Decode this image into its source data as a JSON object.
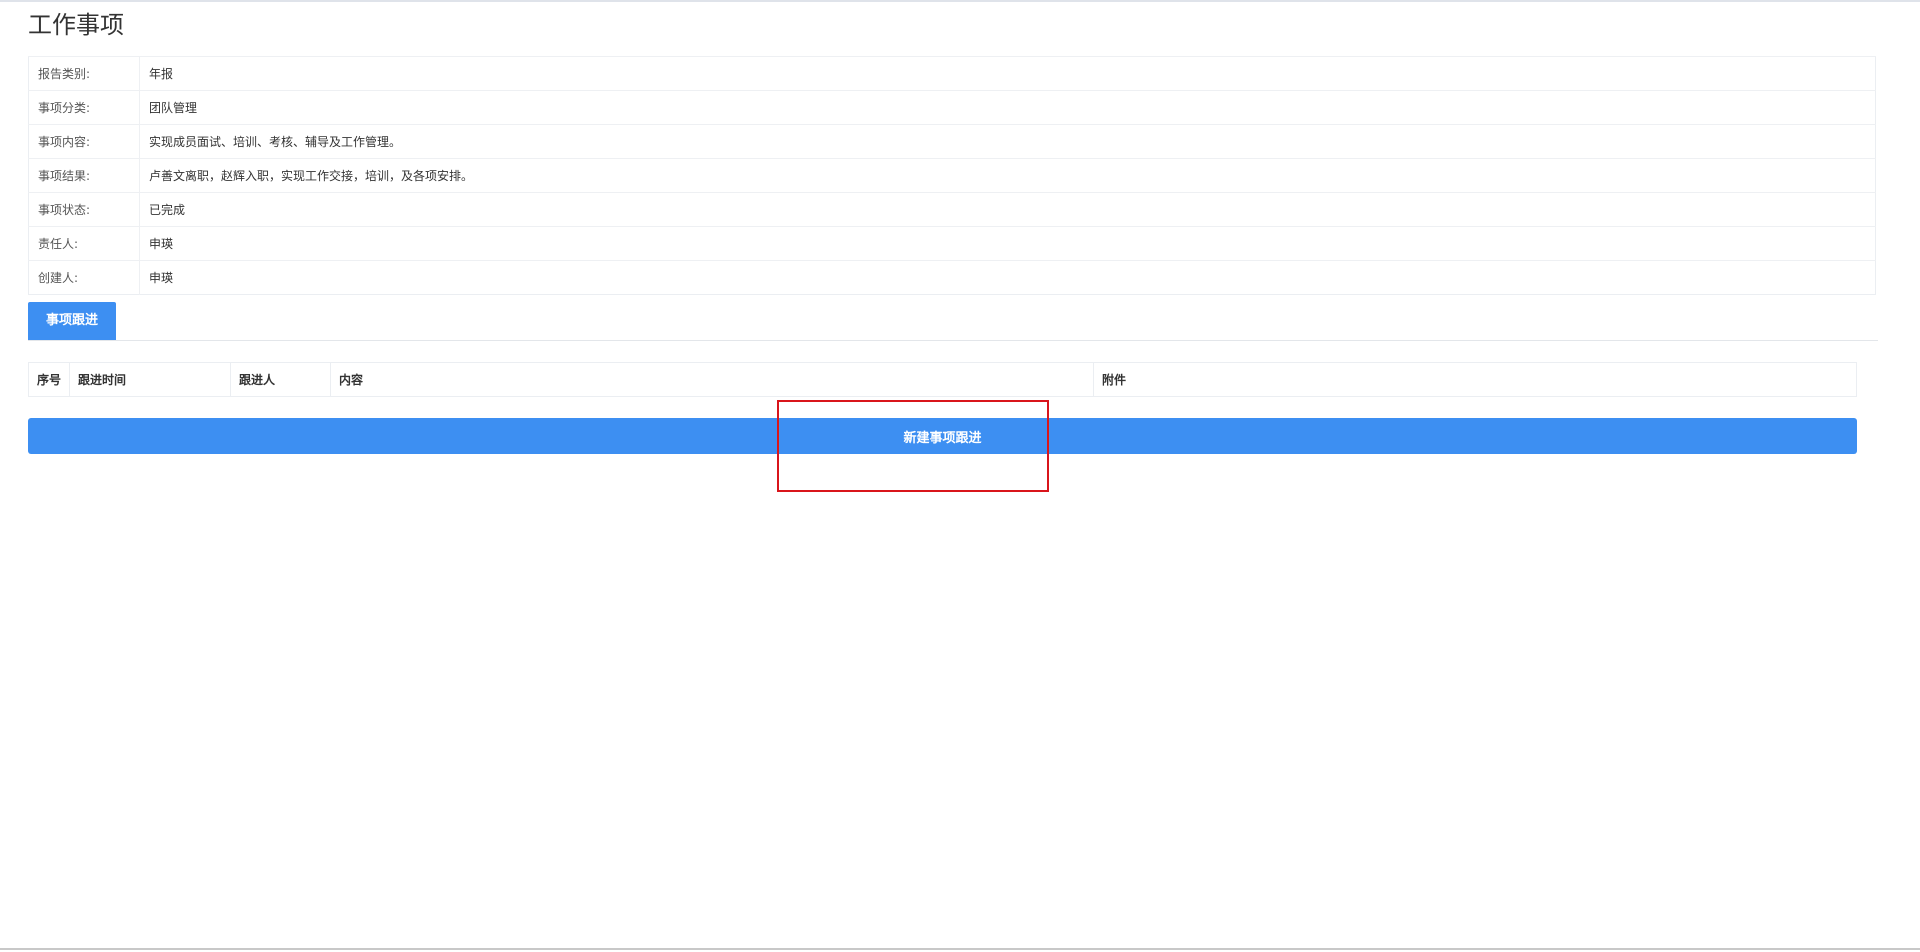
{
  "page": {
    "title": "工作事项"
  },
  "details": [
    {
      "label": "报告类别:",
      "value": "年报"
    },
    {
      "label": "事项分类:",
      "value": "团队管理"
    },
    {
      "label": "事项内容:",
      "value": "实现成员面试、培训、考核、辅导及工作管理。"
    },
    {
      "label": "事项结果:",
      "value": "卢善文离职，赵辉入职，实现工作交接，培训，及各项安排。"
    },
    {
      "label": "事项状态:",
      "value": "已完成"
    },
    {
      "label": "责任人:",
      "value": "申瑛"
    },
    {
      "label": "创建人:",
      "value": "申瑛"
    }
  ],
  "tabs": [
    {
      "label": "事项跟进",
      "active": true
    }
  ],
  "follow_table": {
    "columns": [
      "序号",
      "跟进时间",
      "跟进人",
      "内容",
      "附件"
    ],
    "rows": []
  },
  "actions": {
    "new_follow_label": "新建事项跟进"
  },
  "colors": {
    "primary": "#3d8ff2",
    "highlight": "#d9151b"
  }
}
